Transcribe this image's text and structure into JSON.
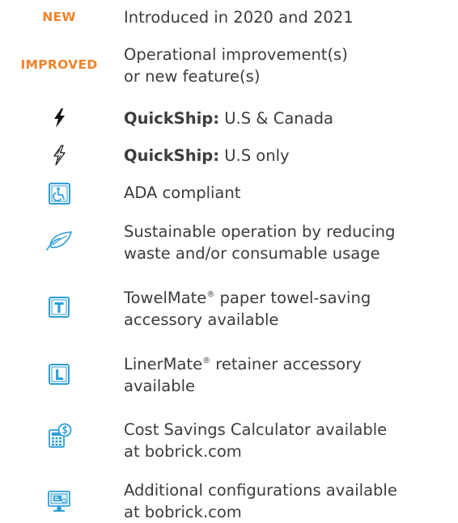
{
  "colors": {
    "badge_orange": "#f0842a",
    "icon_blue": "#2e9ed8",
    "text": "#3c3c3c"
  },
  "rows": [
    {
      "badge": "NEW",
      "lines": [
        "Introduced in 2020 and 2021"
      ]
    },
    {
      "badge": "IMPROVED",
      "lines": [
        "Operational improvement(s)",
        "or new feature(s)"
      ]
    },
    {
      "icon": "lightning-bolt-filled-icon",
      "bold": "QuickShip:",
      "rest": " U.S & Canada"
    },
    {
      "icon": "lightning-bolt-outline-icon",
      "bold": "QuickShip:",
      "rest": " U.S only"
    },
    {
      "icon": "wheelchair-accessibility-icon",
      "lines": [
        "ADA compliant"
      ]
    },
    {
      "icon": "leaf-icon",
      "lines": [
        "Sustainable operation by reducing",
        "waste and/or consumable usage"
      ]
    },
    {
      "icon": "towelmate-t-icon",
      "brand": "TowelMate",
      "reg": "®",
      "line1_rest": " paper towel-saving",
      "lines": [
        "accessory available"
      ]
    },
    {
      "icon": "linermate-l-icon",
      "brand": "LinerMate",
      "reg": "®",
      "line1_rest": " retainer accessory",
      "lines": [
        "available"
      ]
    },
    {
      "icon": "calculator-dollar-icon",
      "lines": [
        "Cost Savings Calculator available",
        "at bobrick.com"
      ]
    },
    {
      "icon": "monitor-config-icon",
      "lines": [
        "Additional configurations available",
        "at bobrick.com"
      ]
    }
  ]
}
